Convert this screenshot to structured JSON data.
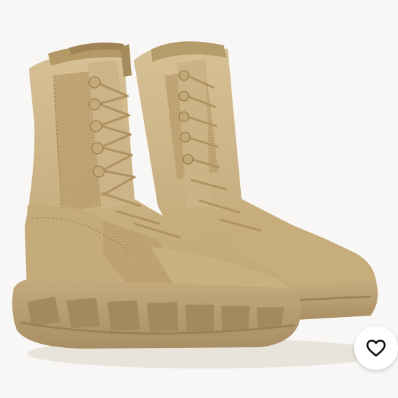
{
  "product_image": {
    "alt": "",
    "colors": {
      "background": "#f8f7f5",
      "suede": "#c9b183",
      "suede_shadow": "#a88c5e",
      "canvas": "#bda272",
      "sole": "#b69c70",
      "lace": "#b89a68"
    }
  },
  "like_button": {
    "icon": "heart-outline-icon",
    "color": "#111111"
  }
}
